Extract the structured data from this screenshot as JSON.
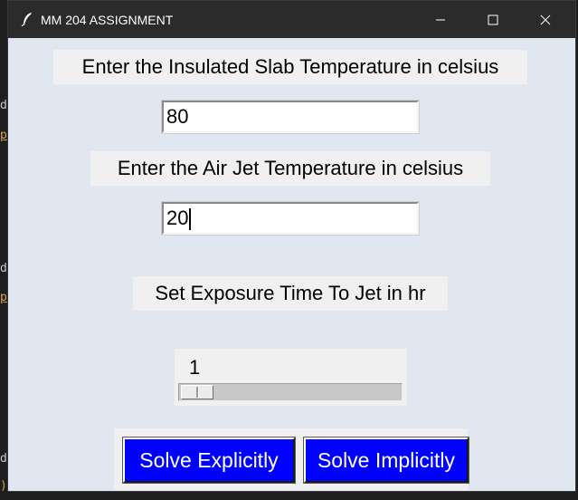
{
  "window": {
    "title": "MM 204 ASSIGNMENT",
    "controls": {
      "minimize": "minimize",
      "maximize": "maximize",
      "close": "close"
    }
  },
  "background_editor": {
    "chars": [
      "d",
      "p",
      "d",
      "p",
      "d",
      ")"
    ]
  },
  "form": {
    "slab_label": "Enter the Insulated Slab Temperature in celsius",
    "slab_value": "80",
    "air_label": "Enter the Air Jet Temperature in celsius",
    "air_value": "20",
    "time_label": "Set Exposure Time To Jet in hr",
    "time_scale": {
      "value": "1",
      "fraction": 0.0
    }
  },
  "buttons": {
    "explicit": "Solve Explicitly",
    "implicit": "Solve Implicitly"
  },
  "colors": {
    "window_bg": "#e0e7f1",
    "label_bg": "#f0f0f0",
    "button_bg": "#0000ff",
    "titlebar_bg": "#2b2b2b"
  },
  "icons": {
    "app": "feather-icon",
    "minimize": "minimize-icon",
    "maximize": "maximize-icon",
    "close": "close-icon"
  }
}
